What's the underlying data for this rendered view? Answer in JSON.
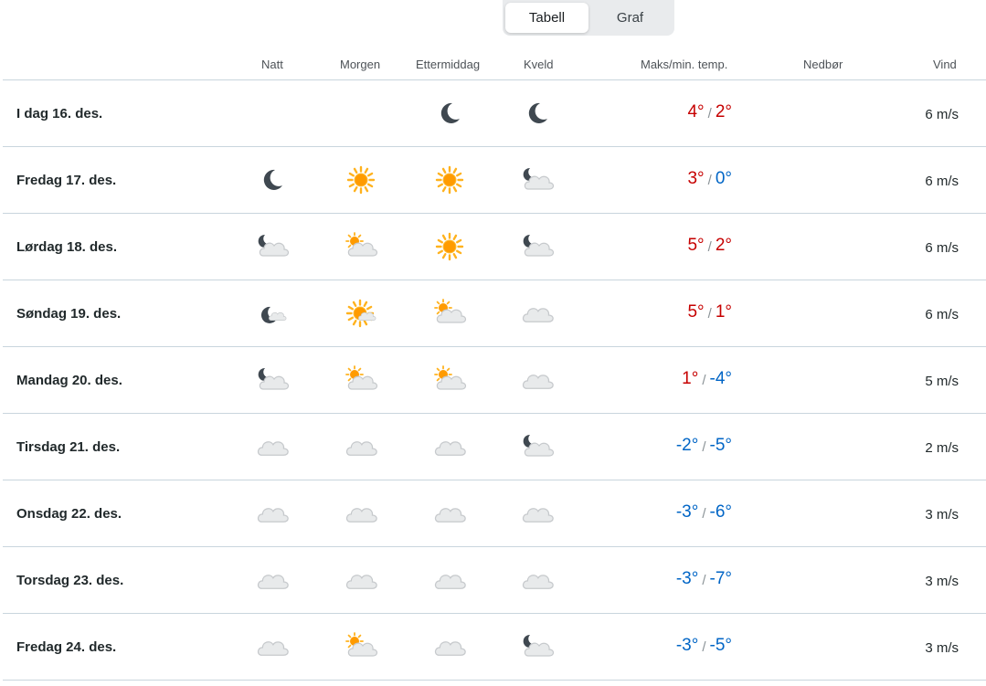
{
  "view_toggle": {
    "table_label": "Tabell",
    "graph_label": "Graf",
    "active": "Tabell"
  },
  "columns": {
    "night": "Natt",
    "morning": "Morgen",
    "afternoon": "Ettermiddag",
    "evening": "Kveld",
    "temp": "Maks/min. temp.",
    "precip": "Nedbør",
    "wind": "Vind"
  },
  "colors": {
    "warm": "#c60000",
    "cold": "#0065c6",
    "divider": "#c9d5dd"
  },
  "rows": [
    {
      "date": "I dag 16. des.",
      "symbols": [
        "",
        "",
        "clear-night-icon",
        "clear-night-icon"
      ],
      "max": "4°",
      "min": "2°",
      "max_warm": true,
      "min_warm": true,
      "precip": "",
      "wind": "6 m/s"
    },
    {
      "date": "Fredag 17. des.",
      "symbols": [
        "clear-night-icon",
        "sun-icon",
        "sun-icon",
        "partly-cloudy-night-icon"
      ],
      "max": "3°",
      "min": "0°",
      "max_warm": true,
      "min_warm": false,
      "precip": "",
      "wind": "6 m/s"
    },
    {
      "date": "Lørdag 18. des.",
      "symbols": [
        "partly-cloudy-night-icon",
        "partly-cloudy-day-icon",
        "sun-icon",
        "partly-cloudy-night-icon"
      ],
      "max": "5°",
      "min": "2°",
      "max_warm": true,
      "min_warm": true,
      "precip": "",
      "wind": "6 m/s"
    },
    {
      "date": "Søndag 19. des.",
      "symbols": [
        "fair-night-icon",
        "fair-day-icon",
        "partly-cloudy-day-icon",
        "cloud-icon"
      ],
      "max": "5°",
      "min": "1°",
      "max_warm": true,
      "min_warm": true,
      "precip": "",
      "wind": "6 m/s"
    },
    {
      "date": "Mandag 20. des.",
      "symbols": [
        "partly-cloudy-night-icon",
        "partly-cloudy-day-icon",
        "partly-cloudy-day-icon",
        "cloud-icon"
      ],
      "max": "1°",
      "min": "-4°",
      "max_warm": true,
      "min_warm": false,
      "precip": "",
      "wind": "5 m/s"
    },
    {
      "date": "Tirsdag 21. des.",
      "symbols": [
        "cloud-icon",
        "cloud-icon",
        "cloud-icon",
        "partly-cloudy-night-icon"
      ],
      "max": "-2°",
      "min": "-5°",
      "max_warm": false,
      "min_warm": false,
      "precip": "",
      "wind": "2 m/s"
    },
    {
      "date": "Onsdag 22. des.",
      "symbols": [
        "cloud-icon",
        "cloud-icon",
        "cloud-icon",
        "cloud-icon"
      ],
      "max": "-3°",
      "min": "-6°",
      "max_warm": false,
      "min_warm": false,
      "precip": "",
      "wind": "3 m/s"
    },
    {
      "date": "Torsdag 23. des.",
      "symbols": [
        "cloud-icon",
        "cloud-icon",
        "cloud-icon",
        "cloud-icon"
      ],
      "max": "-3°",
      "min": "-7°",
      "max_warm": false,
      "min_warm": false,
      "precip": "",
      "wind": "3 m/s"
    },
    {
      "date": "Fredag 24. des.",
      "symbols": [
        "cloud-icon",
        "partly-cloudy-day-icon",
        "cloud-icon",
        "partly-cloudy-night-icon"
      ],
      "max": "-3°",
      "min": "-5°",
      "max_warm": false,
      "min_warm": false,
      "precip": "",
      "wind": "3 m/s"
    }
  ]
}
